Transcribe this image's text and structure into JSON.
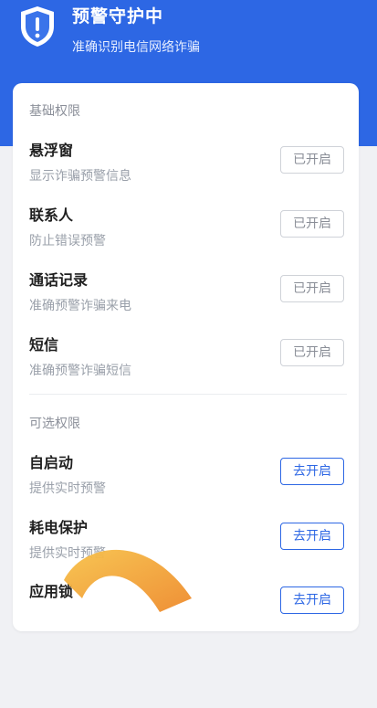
{
  "header": {
    "title": "预警守护中",
    "subtitle": "准确识别电信网络诈骗",
    "icon": "shield-exclamation-icon",
    "color": "#2d67e4"
  },
  "basic": {
    "title": "基础权限",
    "items": [
      {
        "title": "悬浮窗",
        "desc": "显示诈骗预警信息",
        "button": "已开启"
      },
      {
        "title": "联系人",
        "desc": "防止错误预警",
        "button": "已开启"
      },
      {
        "title": "通话记录",
        "desc": "准确预警诈骗来电",
        "button": "已开启"
      },
      {
        "title": "短信",
        "desc": "准确预警诈骗短信",
        "button": "已开启"
      }
    ]
  },
  "optional": {
    "title": "可选权限",
    "items": [
      {
        "title": "自启动",
        "desc": "提供实时预警",
        "button": "去开启"
      },
      {
        "title": "耗电保护",
        "desc": "提供实时预警",
        "button": "去开启"
      },
      {
        "title": "应用锁",
        "desc": "",
        "button": "去开启"
      }
    ]
  },
  "colors": {
    "accent": "#2d67e4",
    "enabled_text": "#8a8e97",
    "overlay_gradient": [
      "#f7c24a",
      "#ee8a2c"
    ]
  }
}
